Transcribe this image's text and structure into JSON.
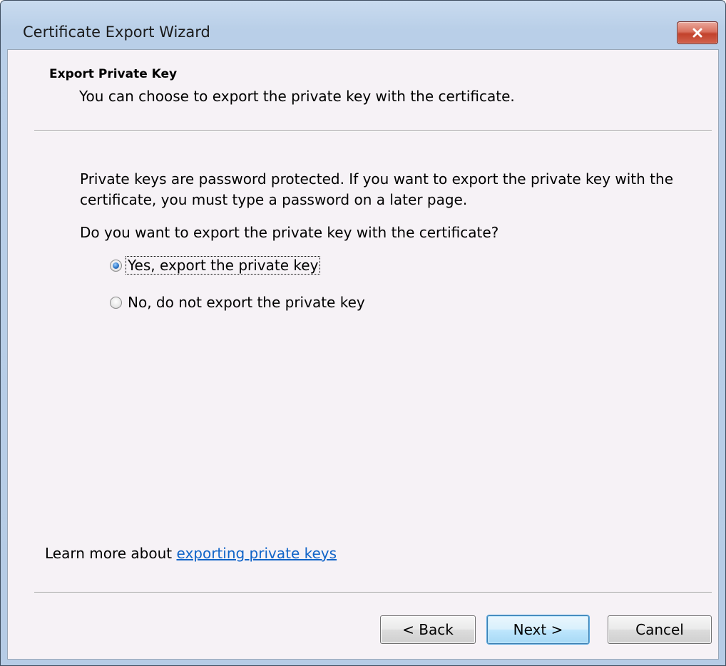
{
  "window": {
    "title": "Certificate Export Wizard"
  },
  "header": {
    "title": "Export Private Key",
    "description": "You can choose to export the private key with the certificate."
  },
  "body": {
    "intro": "Private keys are password protected. If you want to export the private key with the certificate, you must type a password on a later page.",
    "question": "Do you want to export the private key with the certificate?",
    "options": [
      {
        "label": "Yes, export the private key",
        "checked": true
      },
      {
        "label": "No, do not export the private key",
        "checked": false
      }
    ]
  },
  "footer": {
    "learn_more_prefix": "Learn more about ",
    "learn_more_link": "exporting private keys"
  },
  "buttons": {
    "back": "< Back",
    "next": "Next >",
    "cancel": "Cancel"
  },
  "icons": {
    "close": "close-icon"
  },
  "colors": {
    "link": "#1064c8",
    "close_button": "#c2412b",
    "client_background": "#f6f2f6"
  }
}
